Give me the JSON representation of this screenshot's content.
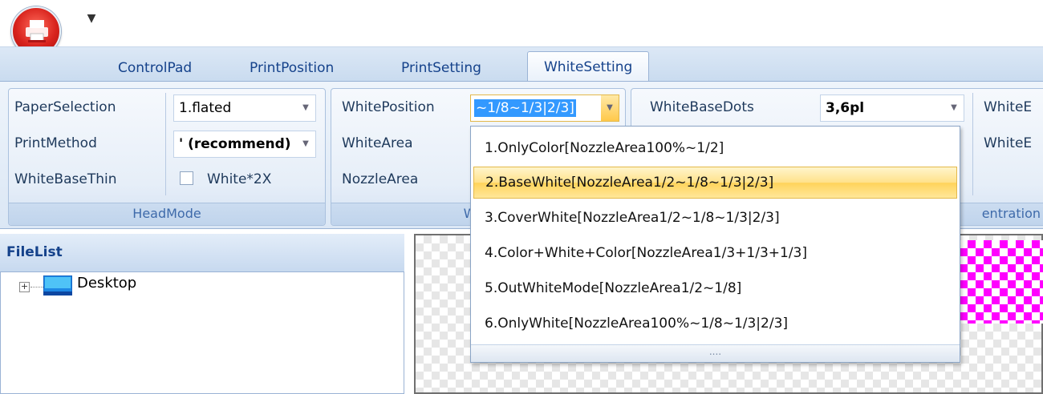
{
  "app": {
    "menu_icon": "printer-icon",
    "qat_icon": "customize-arrow-icon"
  },
  "tabs": [
    {
      "label": "ControlPad"
    },
    {
      "label": "PrintPosition"
    },
    {
      "label": "PrintSetting"
    },
    {
      "label": "WhiteSetting",
      "active": true
    }
  ],
  "headmode": {
    "caption": "HeadMode",
    "paper_label": "PaperSelection",
    "paper_value": "1.flated",
    "method_label": "PrintMethod",
    "method_value": "' (recommend)",
    "thin_label": "WhiteBaseThin",
    "thin_check_label": "White*2X"
  },
  "white": {
    "caption": "Whit",
    "position_label": "WhitePosition",
    "position_value": "~1/8~1/3|2/3]",
    "area_label": "WhiteArea",
    "nozzle_label": "NozzleArea"
  },
  "basedots": {
    "label": "WhiteBaseDots",
    "value": "3,6pl",
    "caption_fragment": "entration",
    "cut_label_1": "WhiteE",
    "cut_label_2": "WhiteE"
  },
  "filelist": {
    "title": "FileList",
    "tree_root": "Desktop"
  },
  "dropdown": {
    "options": [
      "1.OnlyColor[NozzleArea100%~1/2]",
      "2.BaseWhite[NozzleArea1/2~1/8~1/3|2/3]",
      "3.CoverWhite[NozzleArea1/2~1/8~1/3|2/3]",
      "4.Color+White+Color[NozzleArea1/3+1/3+1/3]",
      "5.OutWhiteMode[NozzleArea1/2~1/8]",
      "6.OnlyWhite[NozzleArea100%~1/8~1/3|2/3]"
    ],
    "selected_index": 1,
    "grip": "...."
  },
  "colors": {
    "accent": "#15428b",
    "selection": "#ffe28a",
    "preview_fill": "#ff00ff"
  }
}
